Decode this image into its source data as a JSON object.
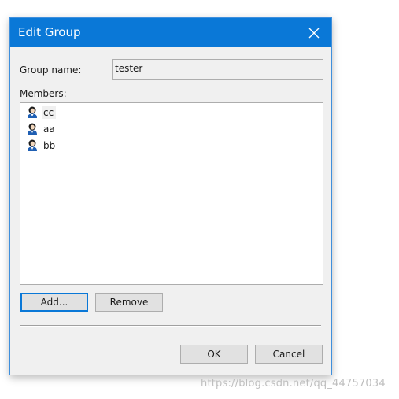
{
  "dialog": {
    "title": "Edit Group",
    "group_name_label": "Group name:",
    "group_name_value": "tester",
    "members_label": "Members:",
    "members": [
      {
        "name": "cc",
        "icon": "user-icon",
        "selected": true
      },
      {
        "name": "aa",
        "icon": "user-icon",
        "selected": false
      },
      {
        "name": "bb",
        "icon": "user-icon",
        "selected": false
      }
    ],
    "add_label": "Add...",
    "remove_label": "Remove",
    "ok_label": "OK",
    "cancel_label": "Cancel"
  },
  "watermark": "https://blog.csdn.net/qq_44757034",
  "colors": {
    "titlebar": "#0a78d7",
    "dialog_bg": "#f0f0f0",
    "button_bg": "#e1e1e1",
    "default_button_border": "#0a78d7"
  }
}
